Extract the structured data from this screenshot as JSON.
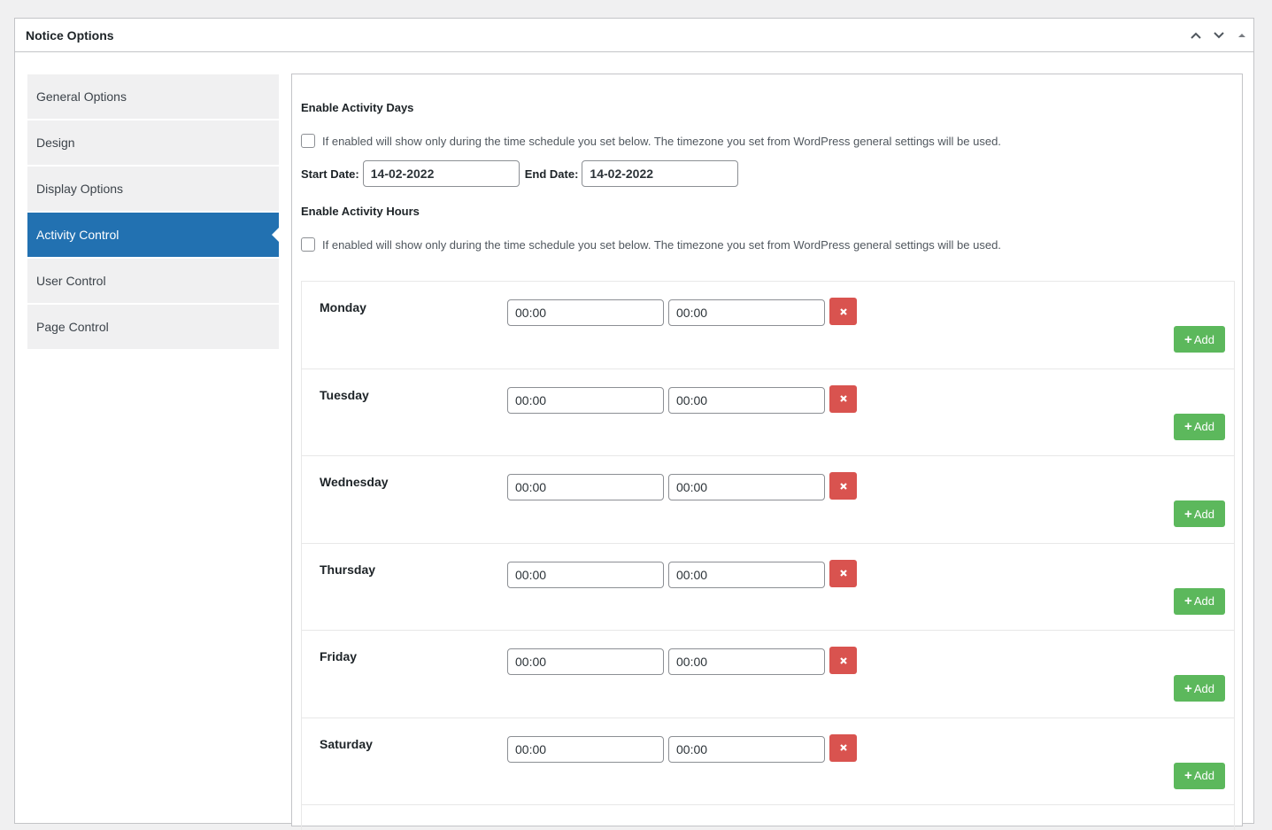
{
  "panel": {
    "title": "Notice Options",
    "actions": [
      "move-up",
      "move-down",
      "toggle-panel"
    ]
  },
  "sidebar": {
    "items": [
      {
        "label": "General Options",
        "active": false
      },
      {
        "label": "Design",
        "active": false
      },
      {
        "label": "Display Options",
        "active": false
      },
      {
        "label": "Activity Control",
        "active": true
      },
      {
        "label": "User Control",
        "active": false
      },
      {
        "label": "Page Control",
        "active": false
      }
    ]
  },
  "activity_days": {
    "heading": "Enable Activity Days",
    "checkbox_label": "If enabled will show only during the time schedule you set below. The timezone you set from WordPress general settings will be used.",
    "checked": false,
    "start_label": "Start Date:",
    "start_value": "14-02-2022",
    "end_label": "End Date:",
    "end_value": "14-02-2022"
  },
  "activity_hours": {
    "heading": "Enable Activity Hours",
    "checkbox_label": "If enabled will show only during the time schedule you set below. The timezone you set from WordPress general settings will be used.",
    "checked": false
  },
  "schedule": {
    "add_label": "Add",
    "days": [
      {
        "name": "Monday",
        "from": "00:00",
        "to": "00:00"
      },
      {
        "name": "Tuesday",
        "from": "00:00",
        "to": "00:00"
      },
      {
        "name": "Wednesday",
        "from": "00:00",
        "to": "00:00"
      },
      {
        "name": "Thursday",
        "from": "00:00",
        "to": "00:00"
      },
      {
        "name": "Friday",
        "from": "00:00",
        "to": "00:00"
      },
      {
        "name": "Saturday",
        "from": "00:00",
        "to": "00:00"
      }
    ]
  },
  "colors": {
    "active_tab": "#2271b1",
    "remove_button": "#d9534f",
    "add_button": "#5cb85c"
  }
}
